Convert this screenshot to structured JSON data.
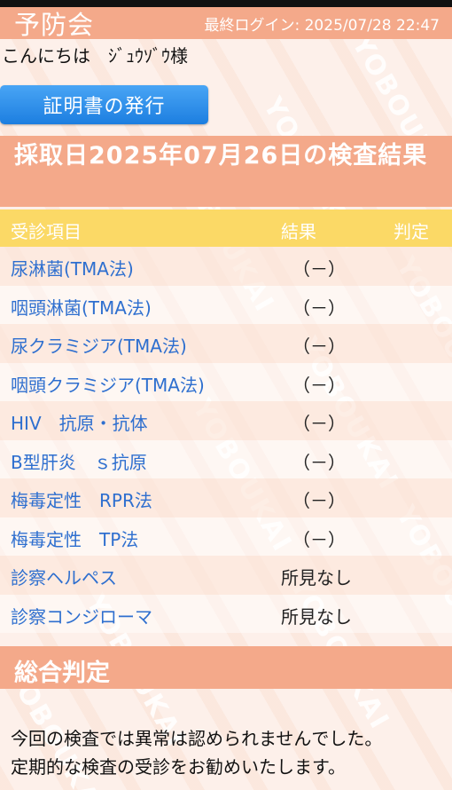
{
  "header": {
    "site_title": "予防会",
    "last_login": "最終ログイン: 2025/07/28 22:47"
  },
  "background_watermark": "YOBOUKAI",
  "greeting": "こんにちは　ｼﾞｭｳｿﾞｳ様",
  "certificate_button": "証明書の発行",
  "result_title": "採取日2025年07月26日の検査結果",
  "table": {
    "headers": {
      "item": "受診項目",
      "result": "結果",
      "judgment": "判定"
    },
    "rows": [
      {
        "item": "尿淋菌(TMA法)",
        "result": "（－）",
        "judgment": ""
      },
      {
        "item": "咽頭淋菌(TMA法)",
        "result": "（－）",
        "judgment": ""
      },
      {
        "item": "尿クラミジア(TMA法)",
        "result": "（－）",
        "judgment": ""
      },
      {
        "item": "咽頭クラミジア(TMA法)",
        "result": "（－）",
        "judgment": ""
      },
      {
        "item": "HIV　抗原・抗体",
        "result": "（－）",
        "judgment": ""
      },
      {
        "item": "B型肝炎　ｓ抗原",
        "result": "（－）",
        "judgment": ""
      },
      {
        "item": "梅毒定性　RPR法",
        "result": "（－）",
        "judgment": ""
      },
      {
        "item": "梅毒定性　TP法",
        "result": "（－）",
        "judgment": ""
      },
      {
        "item": "診察ヘルペス",
        "result": "所見なし",
        "judgment": ""
      },
      {
        "item": "診察コンジローマ",
        "result": "所見なし",
        "judgment": ""
      }
    ]
  },
  "overall": {
    "title": "総合判定",
    "lines": [
      "今回の検査では異常は認められませんでした。",
      "定期的な検査の受診をお勧めいたします。"
    ]
  },
  "colors": {
    "header_bg": "#f4a98a",
    "table_header_bg": "#fbd966",
    "button_bg": "#2b8be8",
    "item_text": "#2e6fcf"
  }
}
